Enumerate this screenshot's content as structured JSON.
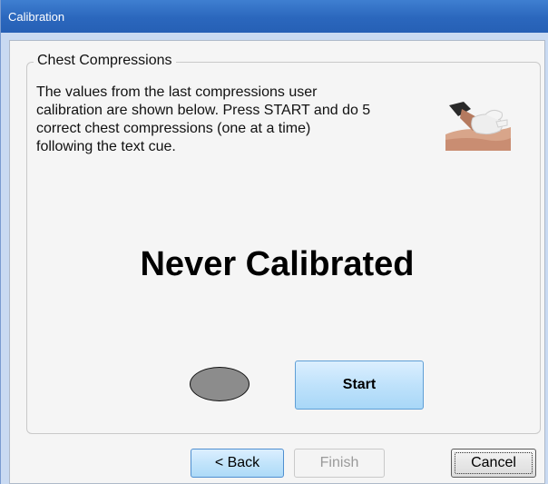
{
  "window": {
    "title": "Calibration"
  },
  "group": {
    "legend": "Chest Compressions",
    "instructions_lines": [
      "The values from the last compressions user",
      "calibration are shown below.  Press START and do 5",
      "correct chest compressions (one at a time)",
      "following the text cue."
    ],
    "photo_icon": "chest-compression-photo",
    "status": "Never Calibrated",
    "indicator_color": "#8c8c8c",
    "start_label": "Start"
  },
  "footer": {
    "back_label": "< Back",
    "finish_label": "Finish",
    "cancel_label": "Cancel"
  }
}
